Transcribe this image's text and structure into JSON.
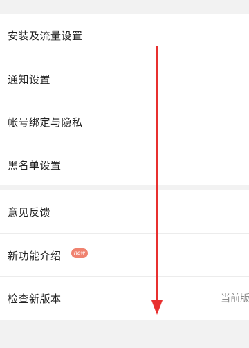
{
  "settings_group_1": {
    "items": [
      {
        "label": "安装及流量设置"
      },
      {
        "label": "通知设置"
      },
      {
        "label": "帐号绑定与隐私"
      },
      {
        "label": "黑名单设置"
      }
    ]
  },
  "settings_group_2": {
    "items": [
      {
        "label": "意见反馈"
      },
      {
        "label": "新功能介绍",
        "badge": "new"
      },
      {
        "label": "检查新版本",
        "value": "当前版"
      }
    ]
  },
  "colors": {
    "background": "#f2f2f2",
    "row": "#ffffff",
    "badge": "#f0826f",
    "arrow": "#e8302f"
  }
}
